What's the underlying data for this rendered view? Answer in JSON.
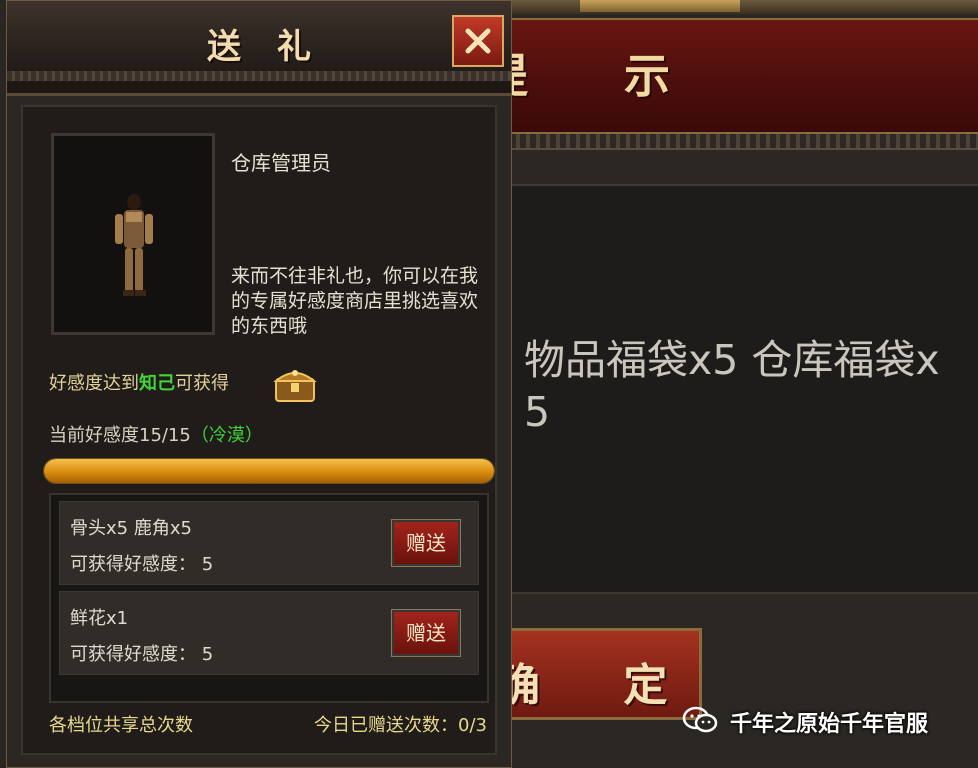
{
  "background_dialog": {
    "title": "提 示",
    "message": "物品福袋x5 仓库福袋x5",
    "confirm_label": "确 定"
  },
  "gift_panel": {
    "title": "送礼",
    "close_icon": "close-x",
    "npc": {
      "name": "仓库管理员",
      "dialogue": "来而不往非礼也，你可以在我的专属好感度商店里挑选喜欢的东西哦"
    },
    "reward": {
      "prefix": "好感度达到",
      "level": "知己",
      "suffix": "可获得",
      "icon": "treasure-chest"
    },
    "affinity": {
      "label": "当前好感度15/15",
      "status": "（冷漠）",
      "progress_fraction": 1.0
    },
    "gifts": [
      {
        "name": "骨头x5 鹿角x5",
        "points": "可获得好感度：  5",
        "button": "赠送"
      },
      {
        "name": "鲜花x1",
        "points": "可获得好感度：  5",
        "button": "赠送"
      }
    ],
    "footer": {
      "left": "各档位共享总次数",
      "right": "今日已赠送次数：0/3"
    }
  },
  "watermark": {
    "icon": "wechat-icon",
    "text": "千年之原始千年官服"
  },
  "colors": {
    "panel_bg": "#2b2723",
    "header_red": "#6a1612",
    "gold_text": "#f3ddb0",
    "highlight_green": "#43d43a",
    "progress_orange": "#e09a18",
    "button_red": "#a1241b"
  }
}
